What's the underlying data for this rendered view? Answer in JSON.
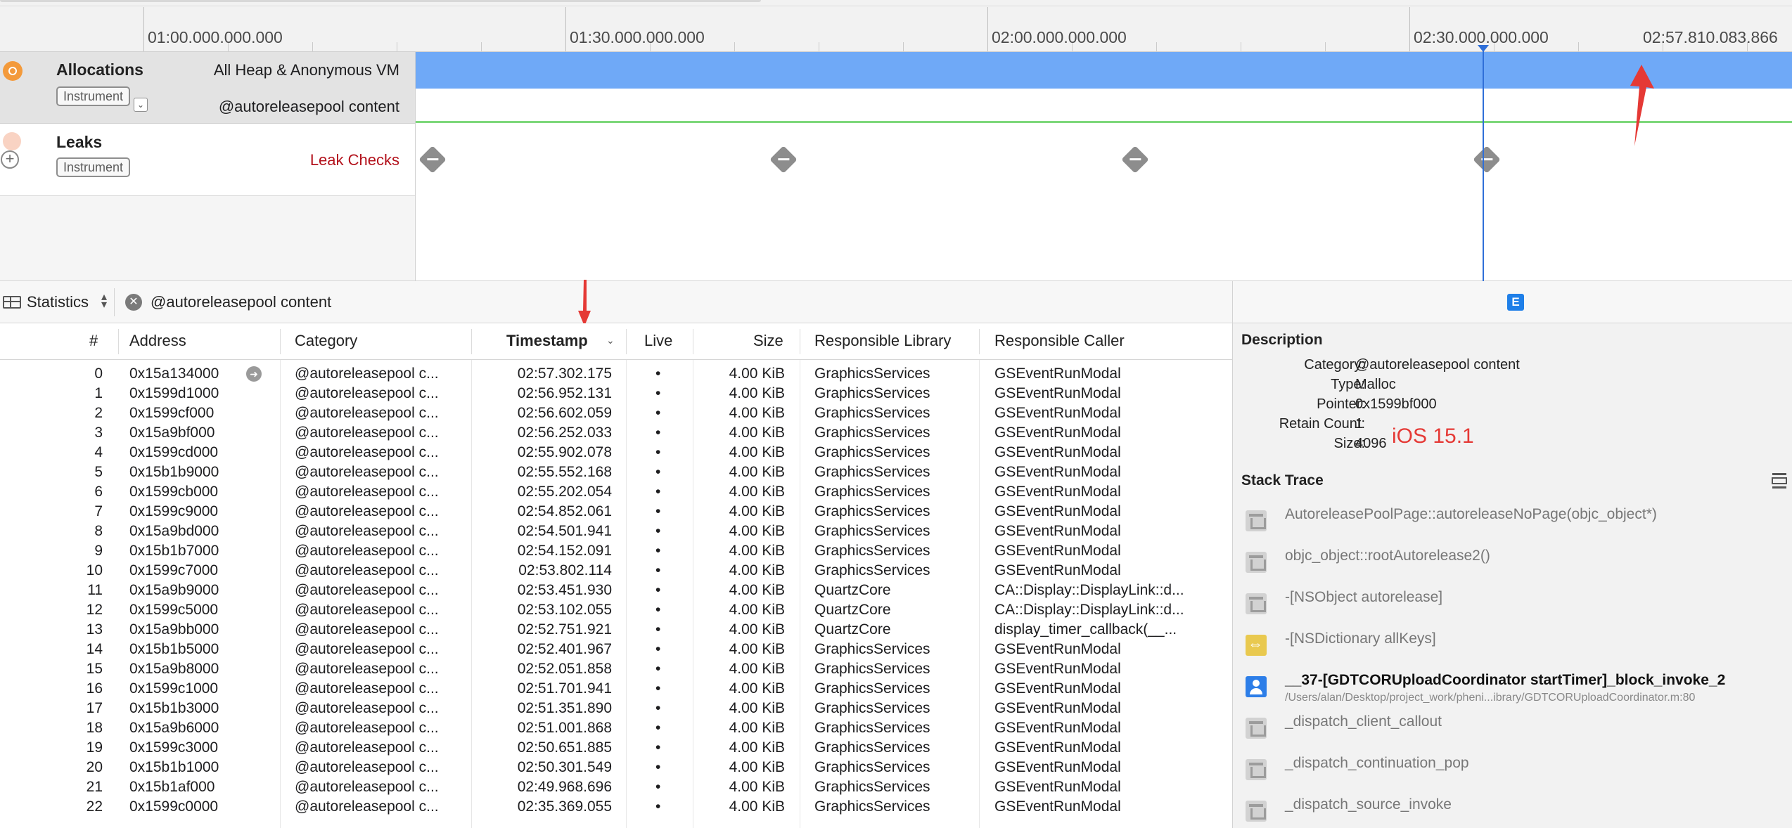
{
  "ruler": {
    "labels": [
      "01:00.000.000.000",
      "01:30.000.000.000",
      "02:00.000.000.000",
      "02:30.000.000.000",
      "02:57.810.083.866"
    ]
  },
  "instruments": {
    "allocations": {
      "name": "Allocations",
      "badge": "Instrument",
      "label_top": "All Heap & Anonymous VM",
      "label_bottom": "@autoreleasepool content"
    },
    "leaks": {
      "name": "Leaks",
      "badge": "Instrument",
      "label": "Leak Checks"
    }
  },
  "detail_bar": {
    "view_label": "Statistics",
    "filter_text": "@autoreleasepool content",
    "extended_detail_button": "E"
  },
  "table": {
    "columns": [
      "#",
      "Address",
      "Category",
      "Timestamp",
      "Live",
      "Size",
      "Responsible Library",
      "Responsible Caller"
    ],
    "sorted_column": "Timestamp",
    "rows": [
      {
        "n": "0",
        "address": "0x15a134000",
        "category": "@autoreleasepool c...",
        "timestamp": "02:57.302.175",
        "live": "•",
        "size": "4.00 KiB",
        "library": "GraphicsServices",
        "caller": "GSEventRunModal"
      },
      {
        "n": "1",
        "address": "0x1599d1000",
        "category": "@autoreleasepool c...",
        "timestamp": "02:56.952.131",
        "live": "•",
        "size": "4.00 KiB",
        "library": "GraphicsServices",
        "caller": "GSEventRunModal"
      },
      {
        "n": "2",
        "address": "0x1599cf000",
        "category": "@autoreleasepool c...",
        "timestamp": "02:56.602.059",
        "live": "•",
        "size": "4.00 KiB",
        "library": "GraphicsServices",
        "caller": "GSEventRunModal"
      },
      {
        "n": "3",
        "address": "0x15a9bf000",
        "category": "@autoreleasepool c...",
        "timestamp": "02:56.252.033",
        "live": "•",
        "size": "4.00 KiB",
        "library": "GraphicsServices",
        "caller": "GSEventRunModal"
      },
      {
        "n": "4",
        "address": "0x1599cd000",
        "category": "@autoreleasepool c...",
        "timestamp": "02:55.902.078",
        "live": "•",
        "size": "4.00 KiB",
        "library": "GraphicsServices",
        "caller": "GSEventRunModal"
      },
      {
        "n": "5",
        "address": "0x15b1b9000",
        "category": "@autoreleasepool c...",
        "timestamp": "02:55.552.168",
        "live": "•",
        "size": "4.00 KiB",
        "library": "GraphicsServices",
        "caller": "GSEventRunModal"
      },
      {
        "n": "6",
        "address": "0x1599cb000",
        "category": "@autoreleasepool c...",
        "timestamp": "02:55.202.054",
        "live": "•",
        "size": "4.00 KiB",
        "library": "GraphicsServices",
        "caller": "GSEventRunModal"
      },
      {
        "n": "7",
        "address": "0x1599c9000",
        "category": "@autoreleasepool c...",
        "timestamp": "02:54.852.061",
        "live": "•",
        "size": "4.00 KiB",
        "library": "GraphicsServices",
        "caller": "GSEventRunModal"
      },
      {
        "n": "8",
        "address": "0x15a9bd000",
        "category": "@autoreleasepool c...",
        "timestamp": "02:54.501.941",
        "live": "•",
        "size": "4.00 KiB",
        "library": "GraphicsServices",
        "caller": "GSEventRunModal"
      },
      {
        "n": "9",
        "address": "0x15b1b7000",
        "category": "@autoreleasepool c...",
        "timestamp": "02:54.152.091",
        "live": "•",
        "size": "4.00 KiB",
        "library": "GraphicsServices",
        "caller": "GSEventRunModal"
      },
      {
        "n": "10",
        "address": "0x1599c7000",
        "category": "@autoreleasepool c...",
        "timestamp": "02:53.802.114",
        "live": "•",
        "size": "4.00 KiB",
        "library": "GraphicsServices",
        "caller": "GSEventRunModal"
      },
      {
        "n": "11",
        "address": "0x15a9b9000",
        "category": "@autoreleasepool c...",
        "timestamp": "02:53.451.930",
        "live": "•",
        "size": "4.00 KiB",
        "library": "QuartzCore",
        "caller": "CA::Display::DisplayLink::d..."
      },
      {
        "n": "12",
        "address": "0x1599c5000",
        "category": "@autoreleasepool c...",
        "timestamp": "02:53.102.055",
        "live": "•",
        "size": "4.00 KiB",
        "library": "QuartzCore",
        "caller": "CA::Display::DisplayLink::d..."
      },
      {
        "n": "13",
        "address": "0x15a9bb000",
        "category": "@autoreleasepool c...",
        "timestamp": "02:52.751.921",
        "live": "•",
        "size": "4.00 KiB",
        "library": "QuartzCore",
        "caller": "display_timer_callback(__..."
      },
      {
        "n": "14",
        "address": "0x15b1b5000",
        "category": "@autoreleasepool c...",
        "timestamp": "02:52.401.967",
        "live": "•",
        "size": "4.00 KiB",
        "library": "GraphicsServices",
        "caller": "GSEventRunModal"
      },
      {
        "n": "15",
        "address": "0x15a9b8000",
        "category": "@autoreleasepool c...",
        "timestamp": "02:52.051.858",
        "live": "•",
        "size": "4.00 KiB",
        "library": "GraphicsServices",
        "caller": "GSEventRunModal"
      },
      {
        "n": "16",
        "address": "0x1599c1000",
        "category": "@autoreleasepool c...",
        "timestamp": "02:51.701.941",
        "live": "•",
        "size": "4.00 KiB",
        "library": "GraphicsServices",
        "caller": "GSEventRunModal"
      },
      {
        "n": "17",
        "address": "0x15b1b3000",
        "category": "@autoreleasepool c...",
        "timestamp": "02:51.351.890",
        "live": "•",
        "size": "4.00 KiB",
        "library": "GraphicsServices",
        "caller": "GSEventRunModal"
      },
      {
        "n": "18",
        "address": "0x15a9b6000",
        "category": "@autoreleasepool c...",
        "timestamp": "02:51.001.868",
        "live": "•",
        "size": "4.00 KiB",
        "library": "GraphicsServices",
        "caller": "GSEventRunModal"
      },
      {
        "n": "19",
        "address": "0x1599c3000",
        "category": "@autoreleasepool c...",
        "timestamp": "02:50.651.885",
        "live": "•",
        "size": "4.00 KiB",
        "library": "GraphicsServices",
        "caller": "GSEventRunModal"
      },
      {
        "n": "20",
        "address": "0x15b1b1000",
        "category": "@autoreleasepool c...",
        "timestamp": "02:50.301.549",
        "live": "•",
        "size": "4.00 KiB",
        "library": "GraphicsServices",
        "caller": "GSEventRunModal"
      },
      {
        "n": "21",
        "address": "0x15b1af000",
        "category": "@autoreleasepool c...",
        "timestamp": "02:49.968.696",
        "live": "•",
        "size": "4.00 KiB",
        "library": "GraphicsServices",
        "caller": "GSEventRunModal"
      },
      {
        "n": "22",
        "address": "0x1599c0000",
        "category": "@autoreleasepool c...",
        "timestamp": "02:35.369.055",
        "live": "•",
        "size": "4.00 KiB",
        "library": "GraphicsServices",
        "caller": "GSEventRunModal"
      }
    ]
  },
  "inspector": {
    "description_title": "Description",
    "fields": [
      {
        "key": "Category:",
        "value": "@autoreleasepool content"
      },
      {
        "key": "Type:",
        "value": "Malloc"
      },
      {
        "key": "Pointer:",
        "value": "0x1599bf000"
      },
      {
        "key": "Retain Count:",
        "value": "1"
      },
      {
        "key": "Size:",
        "value": "4096"
      }
    ],
    "annotation": "iOS 15.1",
    "stack_title": "Stack Trace",
    "frames": [
      {
        "icon": "library-icon",
        "name": "AutoreleasePoolPage::autoreleaseNoPage(objc_object*)",
        "path": ""
      },
      {
        "icon": "library-icon",
        "name": "objc_object::rootAutorelease2()",
        "path": ""
      },
      {
        "icon": "library-icon",
        "name": "-[NSObject autorelease]",
        "path": ""
      },
      {
        "icon": "framework-icon",
        "name": "-[NSDictionary allKeys]",
        "path": ""
      },
      {
        "icon": "user-code-icon",
        "name": "__37-[GDTCORUploadCoordinator startTimer]_block_invoke_2",
        "path": "/Users/alan/Desktop/project_work/pheni...ibrary/GDTCORUploadCoordinator.m:80"
      },
      {
        "icon": "library-icon",
        "name": "_dispatch_client_callout",
        "path": ""
      },
      {
        "icon": "library-icon",
        "name": "_dispatch_continuation_pop",
        "path": ""
      },
      {
        "icon": "library-icon",
        "name": "_dispatch_source_invoke",
        "path": ""
      }
    ]
  },
  "colors": {
    "allocation_lane": "#6fa9f7",
    "playhead": "#2f6fd8",
    "annotation_red": "#e53935",
    "leak_label": "#b3121c"
  }
}
